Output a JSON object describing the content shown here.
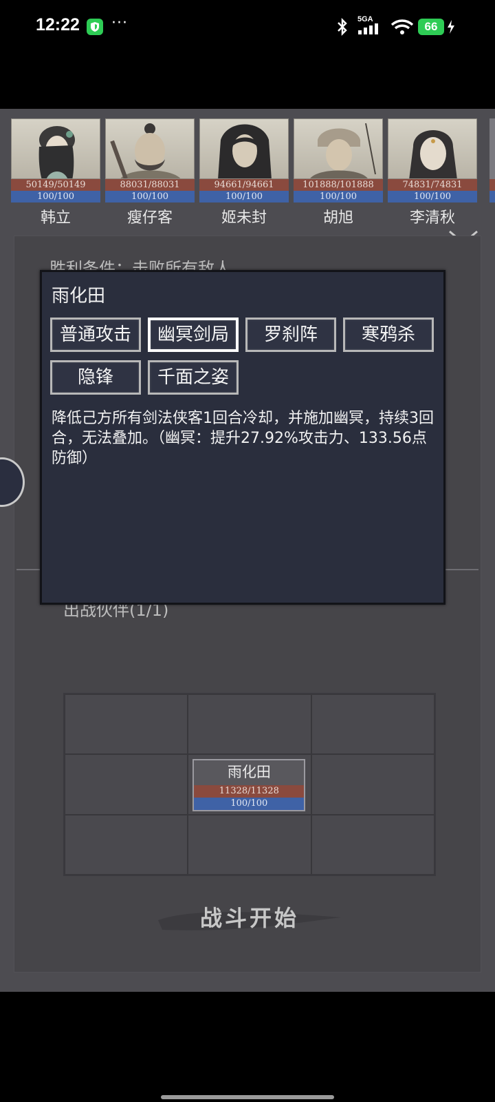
{
  "status_bar": {
    "time": "12:22",
    "more": "···",
    "network": "5GA",
    "battery": "66"
  },
  "heroes": [
    {
      "name": "韩立",
      "hp": "50149/50149",
      "mp": "100/100"
    },
    {
      "name": "瘦仔客",
      "hp": "88031/88031",
      "mp": "100/100"
    },
    {
      "name": "姬未封",
      "hp": "94661/94661",
      "mp": "100/100"
    },
    {
      "name": "胡旭",
      "hp": "101888/101888",
      "mp": "100/100"
    },
    {
      "name": "李清秋",
      "hp": "74831/74831",
      "mp": "100/100"
    }
  ],
  "panel": {
    "victory_condition": "胜利条件：击败所有敌人",
    "team_count": "出战伙伴(1/1)"
  },
  "dialog": {
    "title": "雨化田",
    "skills": [
      {
        "label": "普通攻击",
        "selected": false
      },
      {
        "label": "幽冥剑局",
        "selected": true
      },
      {
        "label": "罗刹阵",
        "selected": false
      },
      {
        "label": "寒鸦杀",
        "selected": false
      },
      {
        "label": "隐锋",
        "selected": false
      },
      {
        "label": "千面之姿",
        "selected": false
      }
    ],
    "description": "降低己方所有剑法侠客1回合冷却，并施加幽冥，持续3回合，无法叠加。（幽冥：提升27.92%攻击力、133.56点防御）"
  },
  "formation": {
    "unit": {
      "name": "雨化田",
      "hp": "11328/11328",
      "mp": "100/100"
    }
  },
  "start_button": "战斗开始",
  "colors": {
    "hp_bar": "#8a4a3e",
    "mp_bar": "#3f62a6",
    "dialog_bg": "#2a2e3d",
    "game_bg": "#4d4c51",
    "status_green": "#2ecc55"
  }
}
